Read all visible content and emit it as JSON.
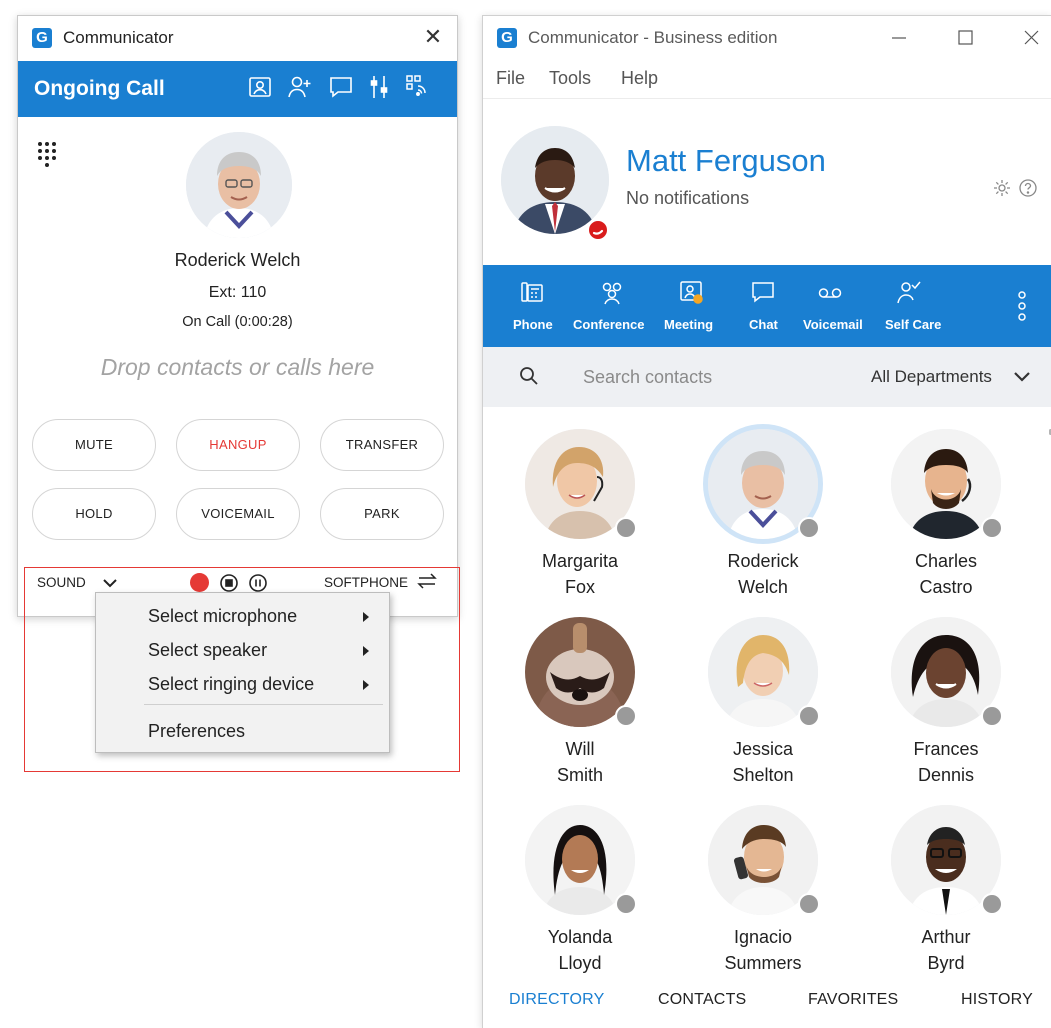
{
  "call_window": {
    "title": "Communicator",
    "close_glyph": "✕",
    "header_title": "Ongoing Call",
    "header_icons": [
      "contact-card-icon",
      "add-person-icon",
      "chat-icon",
      "mixer-icon",
      "touch-grid-icon"
    ],
    "caller": {
      "name": "Roderick Welch",
      "ext": "Ext: 110",
      "status": "On Call (0:00:28)"
    },
    "drop_hint": "Drop contacts or calls here",
    "buttons": {
      "mute": "MUTE",
      "hangup": "HANGUP",
      "transfer": "TRANSFER",
      "hold": "HOLD",
      "voicemail": "VOICEMAIL",
      "park": "PARK"
    },
    "sound_label": "SOUND",
    "softphone_label": "SOFTPHONE"
  },
  "sound_menu": {
    "items": [
      "Select microphone",
      "Select speaker",
      "Select ringing device",
      "Preferences"
    ]
  },
  "main_window": {
    "title": "Communicator - Business edition",
    "menus": [
      "File",
      "Tools",
      "Help"
    ],
    "profile": {
      "name": "Matt Ferguson",
      "notifications": "No notifications"
    },
    "toolbar": [
      "Phone",
      "Conference",
      "Meeting",
      "Chat",
      "Voicemail",
      "Self Care"
    ],
    "search": {
      "placeholder": "Search contacts",
      "department": "All Departments"
    },
    "contacts": [
      {
        "first": "Margarita",
        "last": "Fox"
      },
      {
        "first": "Roderick",
        "last": "Welch"
      },
      {
        "first": "Charles",
        "last": "Castro"
      },
      {
        "first": "Will",
        "last": "Smith"
      },
      {
        "first": "Jessica",
        "last": "Shelton"
      },
      {
        "first": "Frances",
        "last": "Dennis"
      },
      {
        "first": "Yolanda",
        "last": "Lloyd"
      },
      {
        "first": "Ignacio",
        "last": "Summers"
      },
      {
        "first": "Arthur",
        "last": "Byrd"
      }
    ],
    "tabs": [
      "DIRECTORY",
      "CONTACTS",
      "FAVORITES",
      "HISTORY"
    ],
    "active_tab": "DIRECTORY"
  },
  "colors": {
    "brand_blue": "#1a7fd1",
    "hangup_red": "#e53935",
    "status_gray": "#9a9a9a",
    "busy_red": "#d91c1c"
  }
}
